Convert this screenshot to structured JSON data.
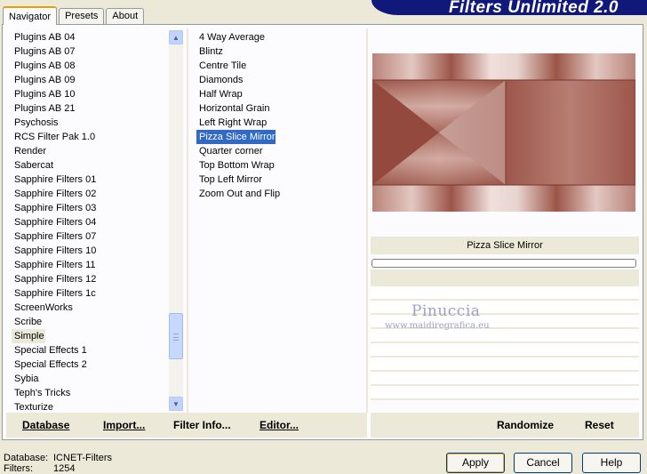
{
  "header": {
    "title": "Filters Unlimited 2.0"
  },
  "tabs": [
    {
      "label": "Navigator",
      "active": true
    },
    {
      "label": "Presets",
      "active": false
    },
    {
      "label": "About",
      "active": false
    }
  ],
  "categories": {
    "items": [
      "Plugins AB 04",
      "Plugins AB 07",
      "Plugins AB 08",
      "Plugins AB 09",
      "Plugins AB 10",
      "Plugins AB 21",
      "Psychosis",
      "RCS Filter Pak 1.0",
      "Render",
      "Sabercat",
      "Sapphire Filters 01",
      "Sapphire Filters 02",
      "Sapphire Filters 03",
      "Sapphire Filters 04",
      "Sapphire Filters 07",
      "Sapphire Filters 10",
      "Sapphire Filters 11",
      "Sapphire Filters 12",
      "Sapphire Filters 1c",
      "ScreenWorks",
      "Scribe",
      "Simple",
      "Special Effects 1",
      "Special Effects 2",
      "Sybia",
      "Teph's Tricks",
      "Texturize"
    ],
    "selected": "Simple"
  },
  "filters": {
    "items": [
      "4 Way Average",
      "Blintz",
      "Centre Tile",
      "Diamonds",
      "Half Wrap",
      "Horizontal Grain",
      "Left Right Wrap",
      "Pizza Slice Mirror",
      "Quarter corner",
      "Top Bottom Wrap",
      "Top Left Mirror",
      "Zoom Out and Flip"
    ],
    "selected": "Pizza Slice Mirror"
  },
  "left_buttons": {
    "database": "Database",
    "import": "Import...",
    "filter_info": "Filter Info...",
    "editor": "Editor..."
  },
  "right_buttons": {
    "randomize": "Randomize",
    "reset": "Reset"
  },
  "preview": {
    "filter_name": "Pizza Slice Mirror",
    "watermark_name": "Pinuccia",
    "watermark_url": "www.maidiregrafica.eu"
  },
  "footer": {
    "database_label": "Database:",
    "database_value": "ICNET-Filters",
    "filters_label": "Filters:",
    "filters_value": "1254"
  },
  "dialog_buttons": {
    "apply": "Apply",
    "cancel": "Cancel",
    "help": "Help"
  },
  "colors": {
    "selection": "#316ac5",
    "header_bg": "#10187a",
    "preview_tone": "#a05a4e"
  }
}
